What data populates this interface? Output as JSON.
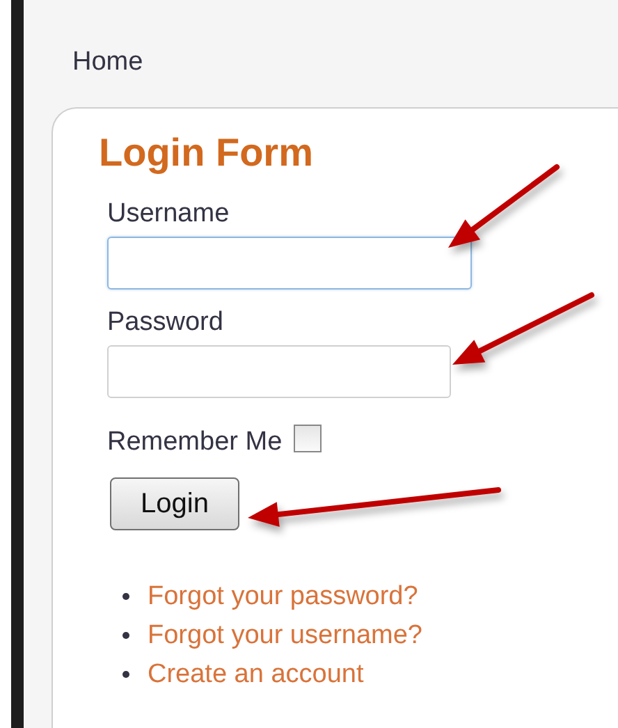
{
  "breadcrumb": "Home",
  "form": {
    "title": "Login Form",
    "fields": [
      {
        "label": "Username",
        "focused": true
      },
      {
        "label": "Password",
        "focused": false
      }
    ],
    "remember": {
      "label": "Remember Me",
      "checked": false
    },
    "button": "Login",
    "links": [
      "Forgot your password?",
      "Forgot your username?",
      "Create an account"
    ]
  },
  "annotations": [
    {
      "kind": "arrow"
    },
    {
      "kind": "arrow"
    },
    {
      "kind": "arrow"
    }
  ]
}
